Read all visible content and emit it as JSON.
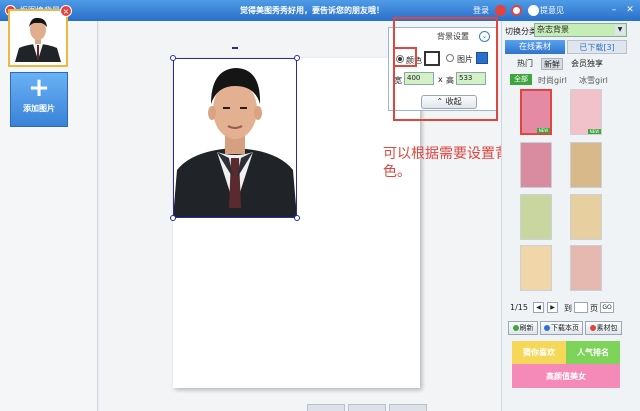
{
  "window": {
    "title": "抠图换背景",
    "slogan": "觉得美图秀秀好用，要告诉您的朋友哦！",
    "login": "登录",
    "feedback": "提意见",
    "min_icon": "minimize-icon",
    "close_icon": "close-icon"
  },
  "left_panel": {
    "add_label": "添加图片",
    "add_icon": "+",
    "delete_icon": "×"
  },
  "bg_settings": {
    "title": "背景设置",
    "toggle_icon": "chevron-down-icon",
    "color_label": "颜色",
    "color_value": "#ffffff",
    "image_label": "图片",
    "width_label": "宽",
    "width_value": "400",
    "times": "x",
    "height_label": "高",
    "height_value": "533",
    "collapse_label": "收起"
  },
  "annotation": {
    "text": "可以根据需要设置背景色。",
    "color": "#e0463f"
  },
  "right_panel": {
    "category_label": "切换分类",
    "category_value": "杂志背景",
    "source_tabs": [
      "在线素材",
      "已下载[3]"
    ],
    "sub_tabs": [
      "热门",
      "新鲜",
      "会员独享"
    ],
    "all_label": "全部",
    "filter_tabs": [
      "时尚girl",
      "冰雪girl"
    ],
    "new_tag": "NEW",
    "tiles": [
      {
        "color": "#e58aa5",
        "new": true
      },
      {
        "color": "#f2c2cb",
        "new": true
      },
      {
        "color": "#d98ba0",
        "new": false
      },
      {
        "color": "#d8b98a",
        "new": false
      },
      {
        "color": "#c9d6a0",
        "new": false
      },
      {
        "color": "#e8cfa0",
        "new": false
      },
      {
        "color": "#f0d6a8",
        "new": false
      },
      {
        "color": "#e6b9b0",
        "new": false
      }
    ],
    "pager": {
      "current": "1/15",
      "goto_label": "到",
      "page_label": "页",
      "go_label": "GO"
    },
    "actions": [
      "刷新",
      "下载本页",
      "素材包"
    ],
    "banners": [
      "猜你喜欢",
      "人气排名",
      "高颜值美女"
    ],
    "accent_color": "#2f73cc"
  }
}
